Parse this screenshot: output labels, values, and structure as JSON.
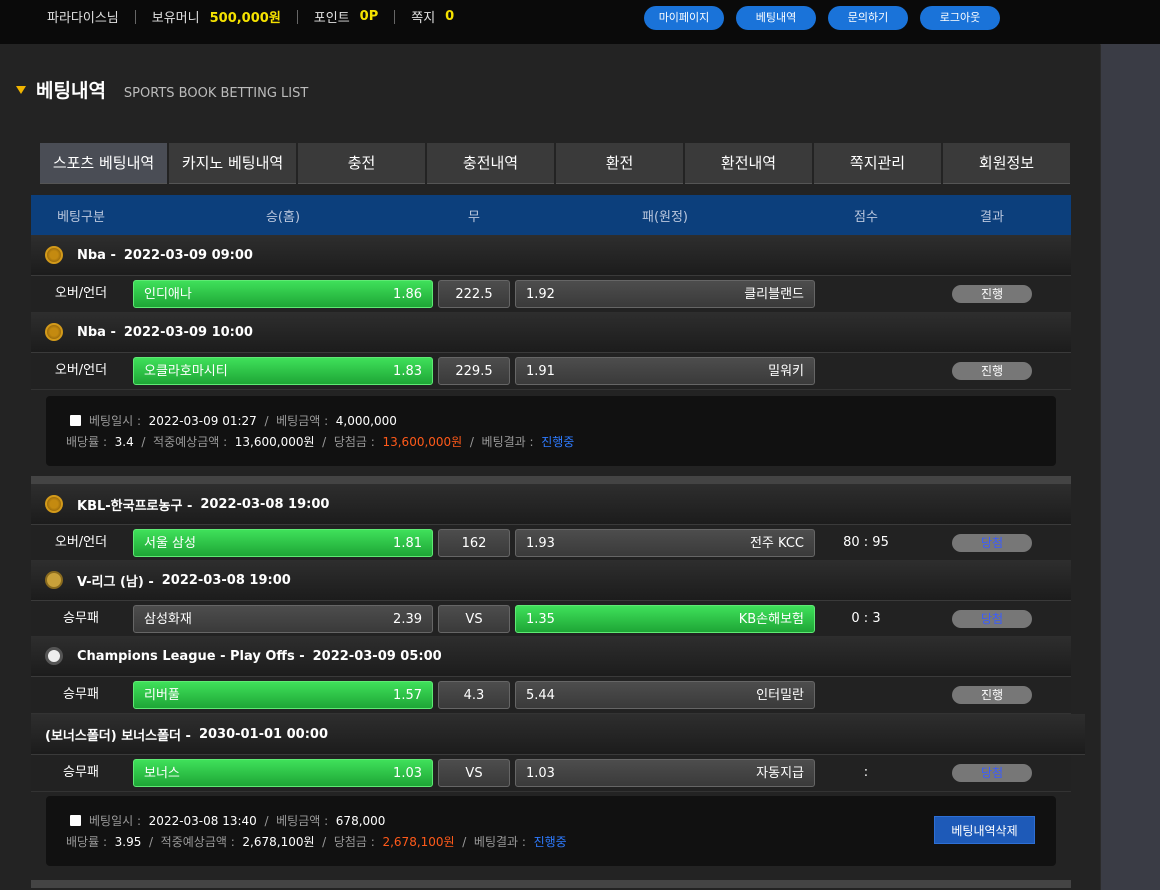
{
  "topbar": {
    "username": "파라다이스님",
    "money_label": "보유머니",
    "money_value": "500,000원",
    "point_label": "포인트",
    "point_value": "0P",
    "note_label": "쪽지",
    "note_value": "0",
    "buttons": [
      "마이페이지",
      "베팅내역",
      "문의하기",
      "로그아웃"
    ]
  },
  "page": {
    "title": "베팅내역",
    "subtitle": "SPORTS BOOK BETTING LIST"
  },
  "tabs": [
    "스포츠 베팅내역",
    "카지노 베팅내역",
    "충전",
    "충전내역",
    "환전",
    "환전내역",
    "쪽지관리",
    "회원정보"
  ],
  "table_header": {
    "type": "베팅구분",
    "home": "승(홈)",
    "draw": "무",
    "away": "패(원정)",
    "score": "점수",
    "result": "결과"
  },
  "slips": [
    {
      "games": [
        {
          "league": "Nba -",
          "time": "2022-03-09 09:00",
          "icon": "basketball-icon",
          "type": "오버/언더",
          "home": "인디애나",
          "home_odds": "1.86",
          "mid": "222.5",
          "away_odds": "1.92",
          "away": "클리블랜드",
          "score": "",
          "result": "진행",
          "win": false,
          "pick": "home"
        },
        {
          "league": "Nba -",
          "time": "2022-03-09 10:00",
          "icon": "basketball-icon",
          "type": "오버/언더",
          "home": "오클라호마시티",
          "home_odds": "1.83",
          "mid": "229.5",
          "away_odds": "1.91",
          "away": "밀워키",
          "score": "",
          "result": "진행",
          "win": false,
          "pick": "home"
        }
      ],
      "info": {
        "bet_time_label": "베팅일시",
        "bet_time": "2022-03-09 01:27",
        "bet_amount_label": "베팅금액",
        "bet_amount": "4,000,000",
        "odds_label": "배당률",
        "odds": "3.4",
        "expected_label": "적중예상금액",
        "expected": "13,600,000원",
        "prize_label": "당첨금",
        "prize": "13,600,000원",
        "result_label": "베팅결과",
        "result": "진행중"
      }
    },
    {
      "games": [
        {
          "league": "KBL-한국프로농구 -",
          "time": "2022-03-08 19:00",
          "icon": "basketball-icon",
          "type": "오버/언더",
          "home": "서울 삼성",
          "home_odds": "1.81",
          "mid": "162",
          "away_odds": "1.93",
          "away": "전주 KCC",
          "score": "80 : 95",
          "result": "당첨",
          "win": true,
          "pick": "home"
        },
        {
          "league": "V-리그 (남) -",
          "time": "2022-03-08 19:00",
          "icon": "volleyball-icon",
          "type": "승무패",
          "home": "삼성화재",
          "home_odds": "2.39",
          "mid": "VS",
          "away_odds": "1.35",
          "away": "KB손해보험",
          "score": "0 : 3",
          "result": "당첨",
          "win": true,
          "pick": "away"
        },
        {
          "league": "Champions League - Play Offs -",
          "time": "2022-03-09 05:00",
          "icon": "soccer-ball-icon",
          "type": "승무패",
          "home": "리버풀",
          "home_odds": "1.57",
          "mid": "4.3",
          "away_odds": "5.44",
          "away": "인터밀란",
          "score": "",
          "result": "진행",
          "win": false,
          "pick": "home"
        },
        {
          "league": "(보너스폴더)  보너스폴더 -",
          "time": "2030-01-01 00:00",
          "icon": "",
          "type": "승무패",
          "home": "보너스",
          "home_odds": "1.03",
          "mid": "VS",
          "away_odds": "1.03",
          "away": "자동지급",
          "score": ":",
          "result": "당첨",
          "win": true,
          "pick": "home"
        }
      ],
      "info": {
        "bet_time_label": "베팅일시",
        "bet_time": "2022-03-08 13:40",
        "bet_amount_label": "베팅금액",
        "bet_amount": "678,000",
        "odds_label": "배당률",
        "odds": "3.95",
        "expected_label": "적중예상금액",
        "expected": "2,678,100원",
        "prize_label": "당첨금",
        "prize": "2,678,100원",
        "result_label": "베팅결과",
        "result": "진행중"
      },
      "delete_label": "베팅내역삭제"
    }
  ]
}
